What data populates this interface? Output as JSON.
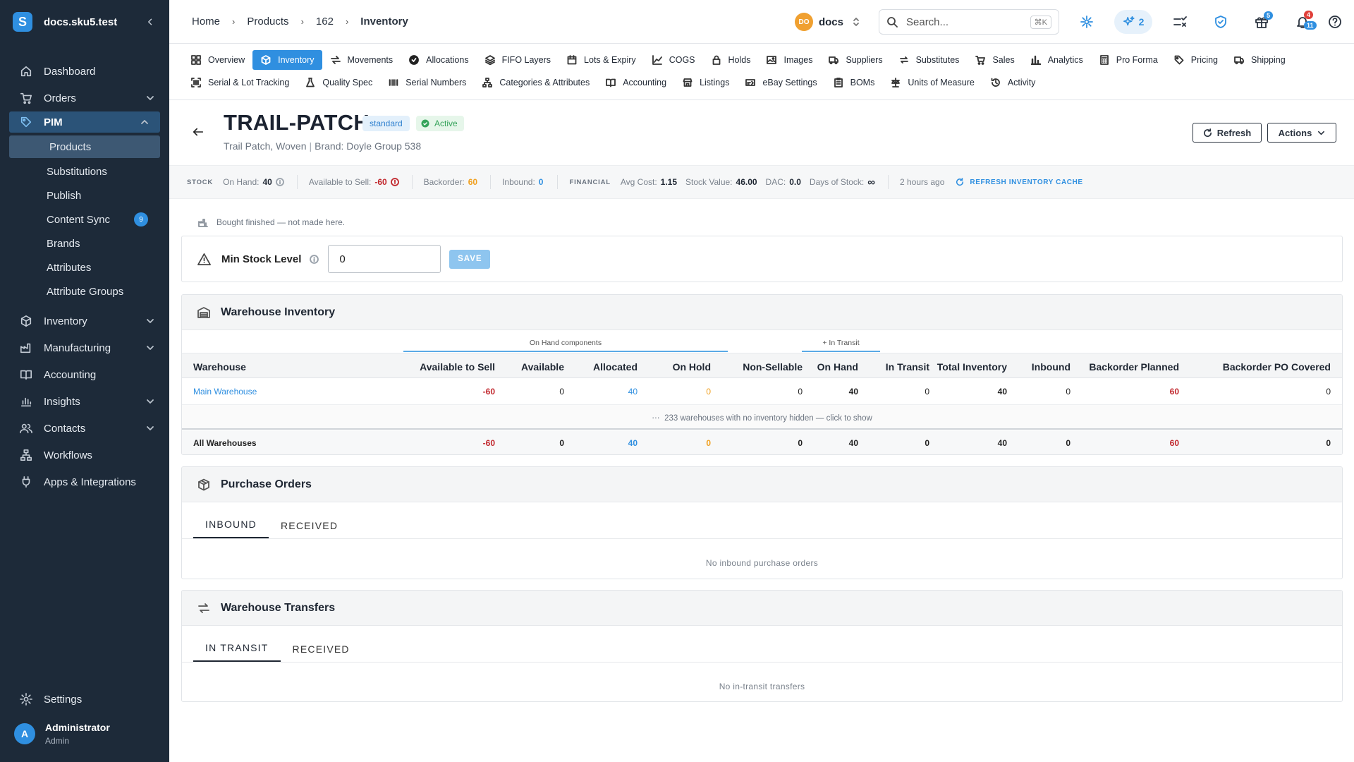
{
  "sidebar": {
    "org": "docs.sku5.test",
    "logo_letter": "S",
    "items": [
      {
        "label": "Dashboard",
        "icon": "home-icon"
      },
      {
        "label": "Orders",
        "icon": "cart-icon"
      },
      {
        "label": "PIM",
        "icon": "tag-icon"
      },
      {
        "label": "Inventory",
        "icon": "box-icon"
      },
      {
        "label": "Manufacturing",
        "icon": "factory-icon"
      },
      {
        "label": "Accounting",
        "icon": "book-icon"
      },
      {
        "label": "Insights",
        "icon": "chart-icon"
      },
      {
        "label": "Contacts",
        "icon": "users-icon"
      },
      {
        "label": "Workflows",
        "icon": "workflow-icon"
      },
      {
        "label": "Apps & Integrations",
        "icon": "plug-icon"
      }
    ],
    "pim_sub": [
      {
        "label": "Products"
      },
      {
        "label": "Substitutions"
      },
      {
        "label": "Publish"
      },
      {
        "label": "Content Sync",
        "badge": "9"
      },
      {
        "label": "Brands"
      },
      {
        "label": "Attributes"
      },
      {
        "label": "Attribute Groups"
      }
    ],
    "settings": "Settings",
    "user": {
      "initial": "A",
      "name": "Administrator",
      "role": "Admin"
    }
  },
  "breadcrumb": [
    "Home",
    "Products",
    "162",
    "Inventory"
  ],
  "topbar": {
    "workspace_badge": "DO",
    "workspace": "docs",
    "search_placeholder": "Search...",
    "search_kbd": "⌘K",
    "ai_count": "2",
    "gift_count": "5",
    "notif_count_red": "4",
    "notif_count_blue": "11"
  },
  "tabs_row1": [
    {
      "label": "Overview",
      "icon": "grid-icon"
    },
    {
      "label": "Inventory",
      "icon": "cube-icon",
      "active": true
    },
    {
      "label": "Movements",
      "icon": "arrows-icon"
    },
    {
      "label": "Allocations",
      "icon": "check-badge-icon"
    },
    {
      "label": "FIFO Layers",
      "icon": "layers-icon"
    },
    {
      "label": "Lots & Expiry",
      "icon": "calendar-icon"
    },
    {
      "label": "COGS",
      "icon": "line-chart-icon"
    },
    {
      "label": "Holds",
      "icon": "lock-icon"
    },
    {
      "label": "Images",
      "icon": "image-icon"
    },
    {
      "label": "Suppliers",
      "icon": "truck-icon"
    },
    {
      "label": "Substitutes",
      "icon": "swap-icon"
    },
    {
      "label": "Sales",
      "icon": "cart-icon"
    },
    {
      "label": "Analytics",
      "icon": "bar-chart-icon"
    },
    {
      "label": "Pro Forma",
      "icon": "calculator-icon"
    },
    {
      "label": "Pricing",
      "icon": "tag-icon"
    },
    {
      "label": "Shipping",
      "icon": "truck-icon"
    }
  ],
  "tabs_row2": [
    {
      "label": "Serial & Lot Tracking",
      "icon": "barcode-scan-icon"
    },
    {
      "label": "Quality Spec",
      "icon": "flask-icon"
    },
    {
      "label": "Serial Numbers",
      "icon": "barcode-icon"
    },
    {
      "label": "Categories & Attributes",
      "icon": "sitemap-icon"
    },
    {
      "label": "Accounting",
      "icon": "book-icon"
    },
    {
      "label": "Listings",
      "icon": "store-icon"
    },
    {
      "label": "eBay Settings",
      "icon": "ebay-icon"
    },
    {
      "label": "BOMs",
      "icon": "clipboard-icon"
    },
    {
      "label": "Units of Measure",
      "icon": "scale-icon"
    },
    {
      "label": "Activity",
      "icon": "history-icon"
    }
  ],
  "product": {
    "sku": "TRAIL-PATCH",
    "type": "standard",
    "status": "Active",
    "name": "Trail Patch, Woven",
    "brand": "Brand: Doyle Group 538",
    "refresh_label": "Refresh",
    "actions_label": "Actions"
  },
  "stats": {
    "stock_tag": "STOCK",
    "on_hand_label": "On Hand:",
    "on_hand": "40",
    "ats_label": "Available to Sell:",
    "ats": "-60",
    "backorder_label": "Backorder:",
    "backorder": "60",
    "inbound_label": "Inbound:",
    "inbound": "0",
    "financial_tag": "FINANCIAL",
    "avg_cost_label": "Avg Cost:",
    "avg_cost": "1.15",
    "stock_value_label": "Stock Value:",
    "stock_value": "46.00",
    "dac_label": "DAC:",
    "dac": "0.0",
    "days_label": "Days of Stock:",
    "days": "∞",
    "updated": "2 hours ago",
    "refresh_cache": "REFRESH INVENTORY CACHE"
  },
  "note": "Bought finished — not made here.",
  "min_stock": {
    "label": "Min Stock Level",
    "value": "0",
    "save": "SAVE"
  },
  "warehouse": {
    "title": "Warehouse Inventory",
    "group_on_hand": "On Hand components",
    "group_transit": "+ In Transit",
    "columns": [
      "Warehouse",
      "Available to Sell",
      "Available",
      "Allocated",
      "On Hold",
      "Non-Sellable",
      "On Hand",
      "In Transit",
      "Total Inventory",
      "Inbound",
      "Backorder Planned",
      "Backorder PO Covered"
    ],
    "rows": [
      [
        "Main Warehouse",
        "-60",
        "0",
        "40",
        "0",
        "0",
        "40",
        "0",
        "40",
        "0",
        "60",
        "0"
      ]
    ],
    "hidden_note": "233 warehouses with no inventory hidden — click to show",
    "totals": [
      "All Warehouses",
      "-60",
      "0",
      "40",
      "0",
      "0",
      "40",
      "0",
      "40",
      "0",
      "60",
      "0"
    ]
  },
  "purchase_orders": {
    "title": "Purchase Orders",
    "tabs": [
      "INBOUND",
      "RECEIVED"
    ],
    "empty": "No inbound purchase orders"
  },
  "transfers": {
    "title": "Warehouse Transfers",
    "tabs": [
      "IN TRANSIT",
      "RECEIVED"
    ],
    "empty": "No in-transit transfers"
  },
  "colors": {
    "accent": "#2f8fe0",
    "sidebar": "#1d2a39",
    "negative": "#c1272d",
    "warning": "#f0a020"
  }
}
